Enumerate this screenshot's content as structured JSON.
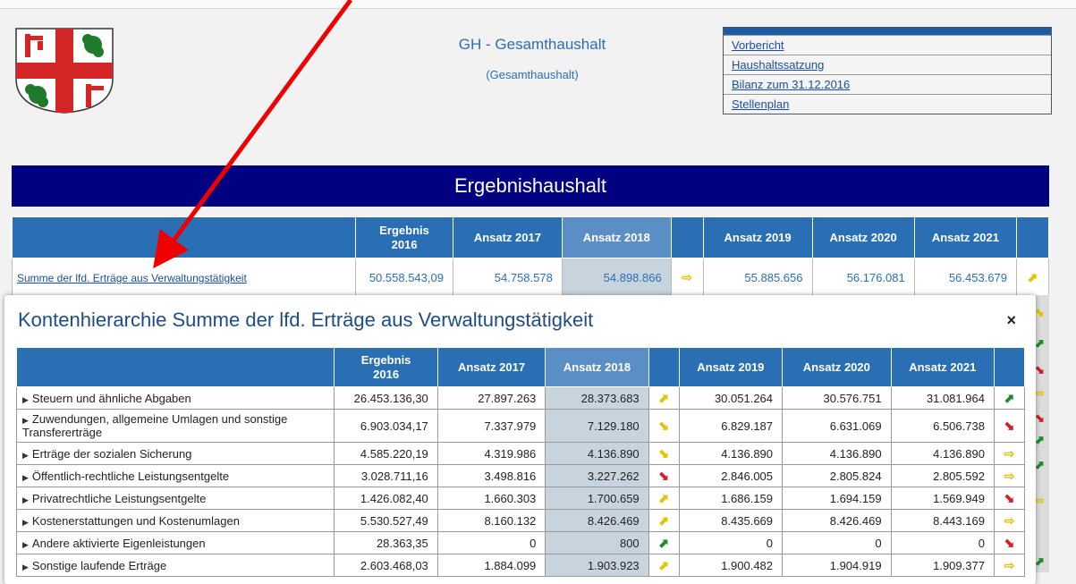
{
  "header": {
    "title": "GH - Gesamthaushalt",
    "subtitle": "(Gesamthaushalt)"
  },
  "links": [
    "Vorbericht",
    "Haushaltssatzung",
    "Bilanz zum 31.12.2016",
    "Stellenplan"
  ],
  "banner": "Ergebnishaushalt",
  "columns": {
    "ergebnis": "Ergebnis\n2016",
    "a2017": "Ansatz 2017",
    "a2018": "Ansatz 2018",
    "a2019": "Ansatz 2019",
    "a2020": "Ansatz 2020",
    "a2021": "Ansatz 2021"
  },
  "summary_row": {
    "label": "Summe der lfd. Erträge aus Verwaltungstätigkeit",
    "e2016": "50.558.543,09",
    "a2017": "54.758.578",
    "a2018": "54.898.866",
    "a2019": "55.885.656",
    "a2020": "56.176.081",
    "a2021": "56.453.679",
    "trend1": "arrow-right-yellow",
    "trend2": "arrow-up-yellow"
  },
  "modal": {
    "title": "Kontenhierarchie Summe der lfd. Erträge aus Verwaltungstätigkeit",
    "close": "×",
    "rows": [
      {
        "label": "Steuern und ähnliche Abgaben",
        "e2016": "26.453.136,30",
        "a2017": "27.897.263",
        "a2018": "28.373.683",
        "t1": "arrow-up-yellow",
        "a2019": "30.051.264",
        "a2020": "30.576.751",
        "a2021": "31.081.964",
        "t2": "arrow-up-green"
      },
      {
        "label": "Zuwendungen, allgemeine Umlagen und sonstige Transfererträge",
        "e2016": "6.903.034,17",
        "a2017": "7.337.979",
        "a2018": "7.129.180",
        "t1": "arrow-down-yellow",
        "a2019": "6.829.187",
        "a2020": "6.631.069",
        "a2021": "6.506.738",
        "t2": "arrow-down-red"
      },
      {
        "label": "Erträge der sozialen Sicherung",
        "e2016": "4.585.220,19",
        "a2017": "4.319.986",
        "a2018": "4.136.890",
        "t1": "arrow-down-yellow",
        "a2019": "4.136.890",
        "a2020": "4.136.890",
        "a2021": "4.136.890",
        "t2": "arrow-right-yellow"
      },
      {
        "label": "Öffentlich-rechtliche Leistungsentgelte",
        "e2016": "3.028.711,16",
        "a2017": "3.498.816",
        "a2018": "3.227.262",
        "t1": "arrow-down-red",
        "a2019": "2.846.005",
        "a2020": "2.805.824",
        "a2021": "2.805.592",
        "t2": "arrow-right-yellow"
      },
      {
        "label": "Privatrechtliche Leistungsentgelte",
        "e2016": "1.426.082,40",
        "a2017": "1.660.303",
        "a2018": "1.700.659",
        "t1": "arrow-up-yellow",
        "a2019": "1.686.159",
        "a2020": "1.694.159",
        "a2021": "1.569.949",
        "t2": "arrow-down-red"
      },
      {
        "label": "Kostenerstattungen und Kostenumlagen",
        "e2016": "5.530.527,49",
        "a2017": "8.160.132",
        "a2018": "8.426.469",
        "t1": "arrow-up-yellow",
        "a2019": "8.435.669",
        "a2020": "8.426.469",
        "a2021": "8.443.169",
        "t2": "arrow-right-yellow"
      },
      {
        "label": "Andere aktivierte Eigenleistungen",
        "e2016": "28.363,35",
        "a2017": "0",
        "a2018": "800",
        "t1": "arrow-up-green",
        "a2019": "0",
        "a2020": "0",
        "a2021": "0",
        "t2": "arrow-down-red"
      },
      {
        "label": "Sonstige laufende Erträge",
        "e2016": "2.603.468,03",
        "a2017": "1.884.099",
        "a2018": "1.903.923",
        "t1": "arrow-up-yellow",
        "a2019": "1.900.482",
        "a2020": "1.904.919",
        "a2021": "1.909.377",
        "t2": "arrow-right-yellow"
      }
    ]
  },
  "colors": {
    "header_blue": "#2a6fb4",
    "banner_navy": "#000080",
    "highlight_gray": "#c8d4dd",
    "annotation_red": "#ee0000"
  }
}
